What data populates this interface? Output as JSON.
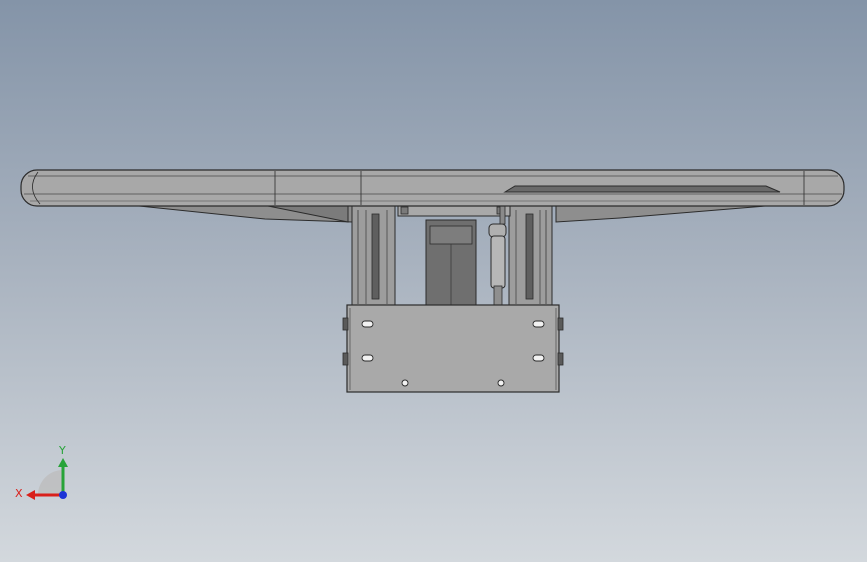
{
  "viewport": {
    "colors": {
      "background_top": "#8494a8",
      "background_bottom": "#d3d8dd",
      "part_fill": "#a6a6a6",
      "part_dark": "#6f6f6f",
      "edge": "#2b2b2b"
    }
  },
  "model": {
    "parts": [
      "top-panel",
      "left-arm",
      "right-arm",
      "center-motor",
      "gas-spring",
      "mount-bracket",
      "fasteners"
    ]
  },
  "triad": {
    "x_label": "X",
    "y_label": "Y",
    "colors": {
      "x": "#d9201b",
      "y": "#27a338",
      "z": "#1d34d6"
    }
  }
}
